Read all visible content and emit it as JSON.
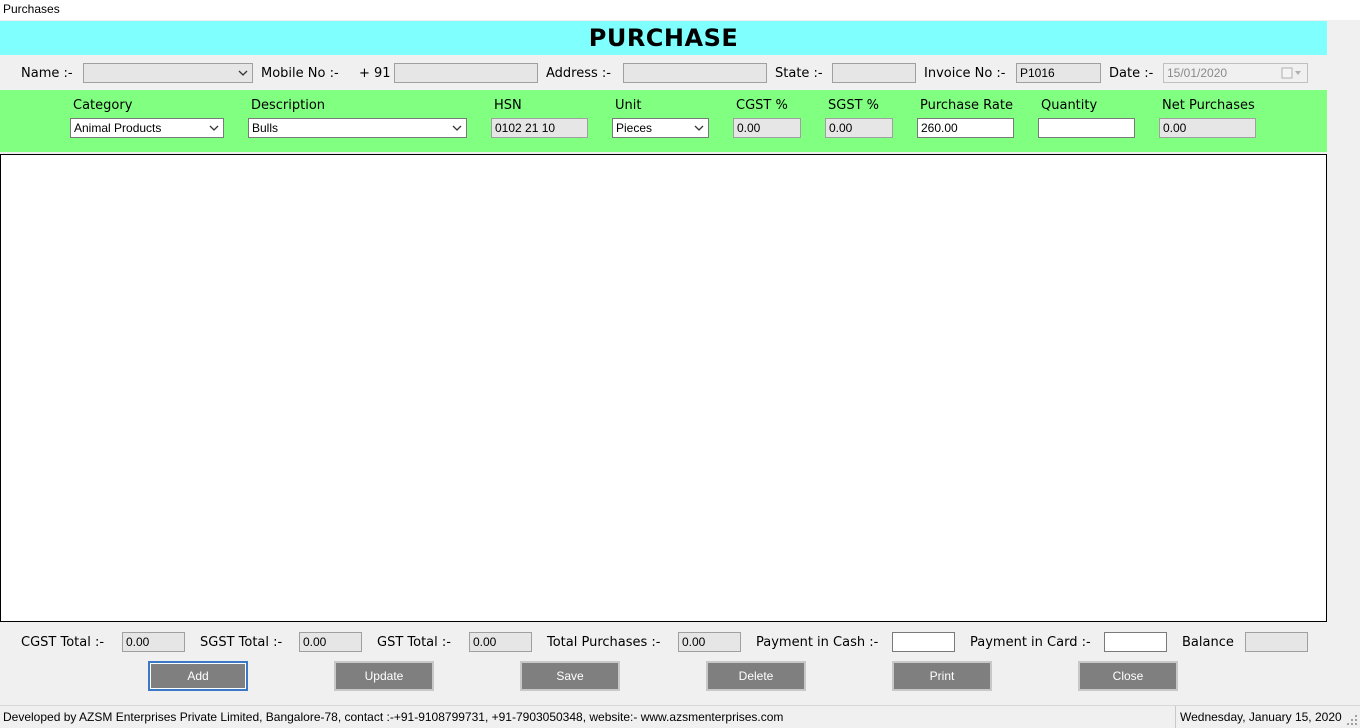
{
  "window": {
    "title": "Purchases"
  },
  "header": {
    "title": "PURCHASE"
  },
  "customer": {
    "name_label": "Name :-",
    "name_value": "",
    "mobile_label": "Mobile No :-",
    "mobile_prefix": "+ 91",
    "mobile_value": "",
    "address_label": "Address :-",
    "address_value": "",
    "state_label": "State :-",
    "state_value": "",
    "invoice_label": "Invoice No :-",
    "invoice_value": "P1016",
    "date_label": "Date :-",
    "date_value": "15/01/2020"
  },
  "item": {
    "category_label": "Category",
    "category_value": "Animal Products",
    "description_label": "Description",
    "description_value": "Bulls",
    "hsn_label": "HSN",
    "hsn_value": "0102 21 10",
    "unit_label": "Unit",
    "unit_value": "Pieces",
    "cgst_label": "CGST %",
    "cgst_value": "0.00",
    "sgst_label": "SGST %",
    "sgst_value": "0.00",
    "rate_label": "Purchase Rate",
    "rate_value": "260.00",
    "quantity_label": "Quantity",
    "quantity_value": "",
    "net_label": "Net Purchases",
    "net_value": "0.00"
  },
  "totals": {
    "cgst_label": "CGST Total :-",
    "cgst_value": "0.00",
    "sgst_label": "SGST Total :-",
    "sgst_value": "0.00",
    "gst_label": "GST Total :-",
    "gst_value": "0.00",
    "purchases_label": "Total Purchases :-",
    "purchases_value": "0.00",
    "cash_label": "Payment in Cash :-",
    "cash_value": "",
    "card_label": "Payment in Card :-",
    "card_value": "",
    "balance_label": "Balance",
    "balance_value": ""
  },
  "buttons": {
    "add": "Add",
    "update": "Update",
    "save": "Save",
    "delete": "Delete",
    "print": "Print",
    "close": "Close"
  },
  "status": {
    "developer": "Developed by AZSM Enterprises Private Limited, Bangalore-78, contact :-+91-9108799731, +91-7903050348, website:- www.azsmenterprises.com",
    "date": "Wednesday, January 15, 2020"
  },
  "colors": {
    "banner": "#80ffff",
    "item_band": "#80ff80",
    "button": "#7f7f7f"
  }
}
